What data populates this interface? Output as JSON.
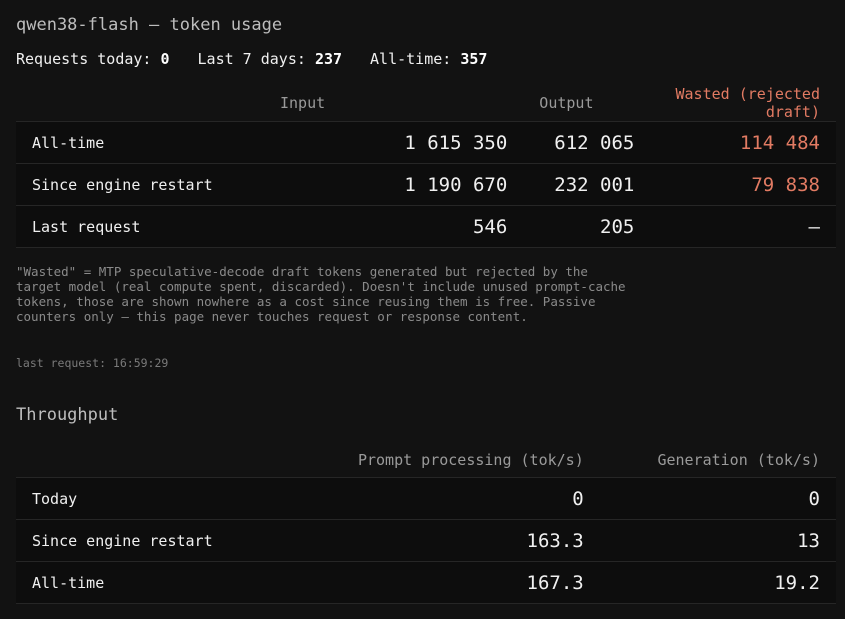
{
  "title": "qwen38-flash — token usage",
  "stats": [
    {
      "label": "Requests today:",
      "value": "0"
    },
    {
      "label": "Last 7 days:",
      "value": "237"
    },
    {
      "label": "All-time:",
      "value": "357"
    }
  ],
  "usage": {
    "headers": {
      "input": "Input",
      "output": "Output",
      "wasted": "Wasted (rejected draft)"
    },
    "rows": [
      {
        "label": "All-time",
        "input": "1 615 350",
        "output": "612 065",
        "wasted": "114 484"
      },
      {
        "label": "Since engine restart",
        "input": "1 190 670",
        "output": "232 001",
        "wasted": "79 838"
      },
      {
        "label": "Last request",
        "input": "546",
        "output": "205",
        "wasted": "—"
      }
    ]
  },
  "note": "\"Wasted\" = MTP speculative-decode draft tokens generated but rejected by the target model (real compute spent, discarded). Doesn't include unused prompt-cache tokens, those are shown nowhere as a cost since reusing them is free. Passive counters only — this page never touches request or response content.",
  "last_request": "last request: 16:59:29",
  "throughput": {
    "title": "Throughput",
    "headers": {
      "prompt": "Prompt processing (tok/s)",
      "generation": "Generation (tok/s)"
    },
    "rows": [
      {
        "label": "Today",
        "prompt": "0",
        "generation": "0"
      },
      {
        "label": "Since engine restart",
        "prompt": "163.3",
        "generation": "13"
      },
      {
        "label": "All-time",
        "prompt": "167.3",
        "generation": "19.2"
      }
    ]
  },
  "colors": {
    "background": "#121212",
    "wasted": "#e27b63"
  }
}
